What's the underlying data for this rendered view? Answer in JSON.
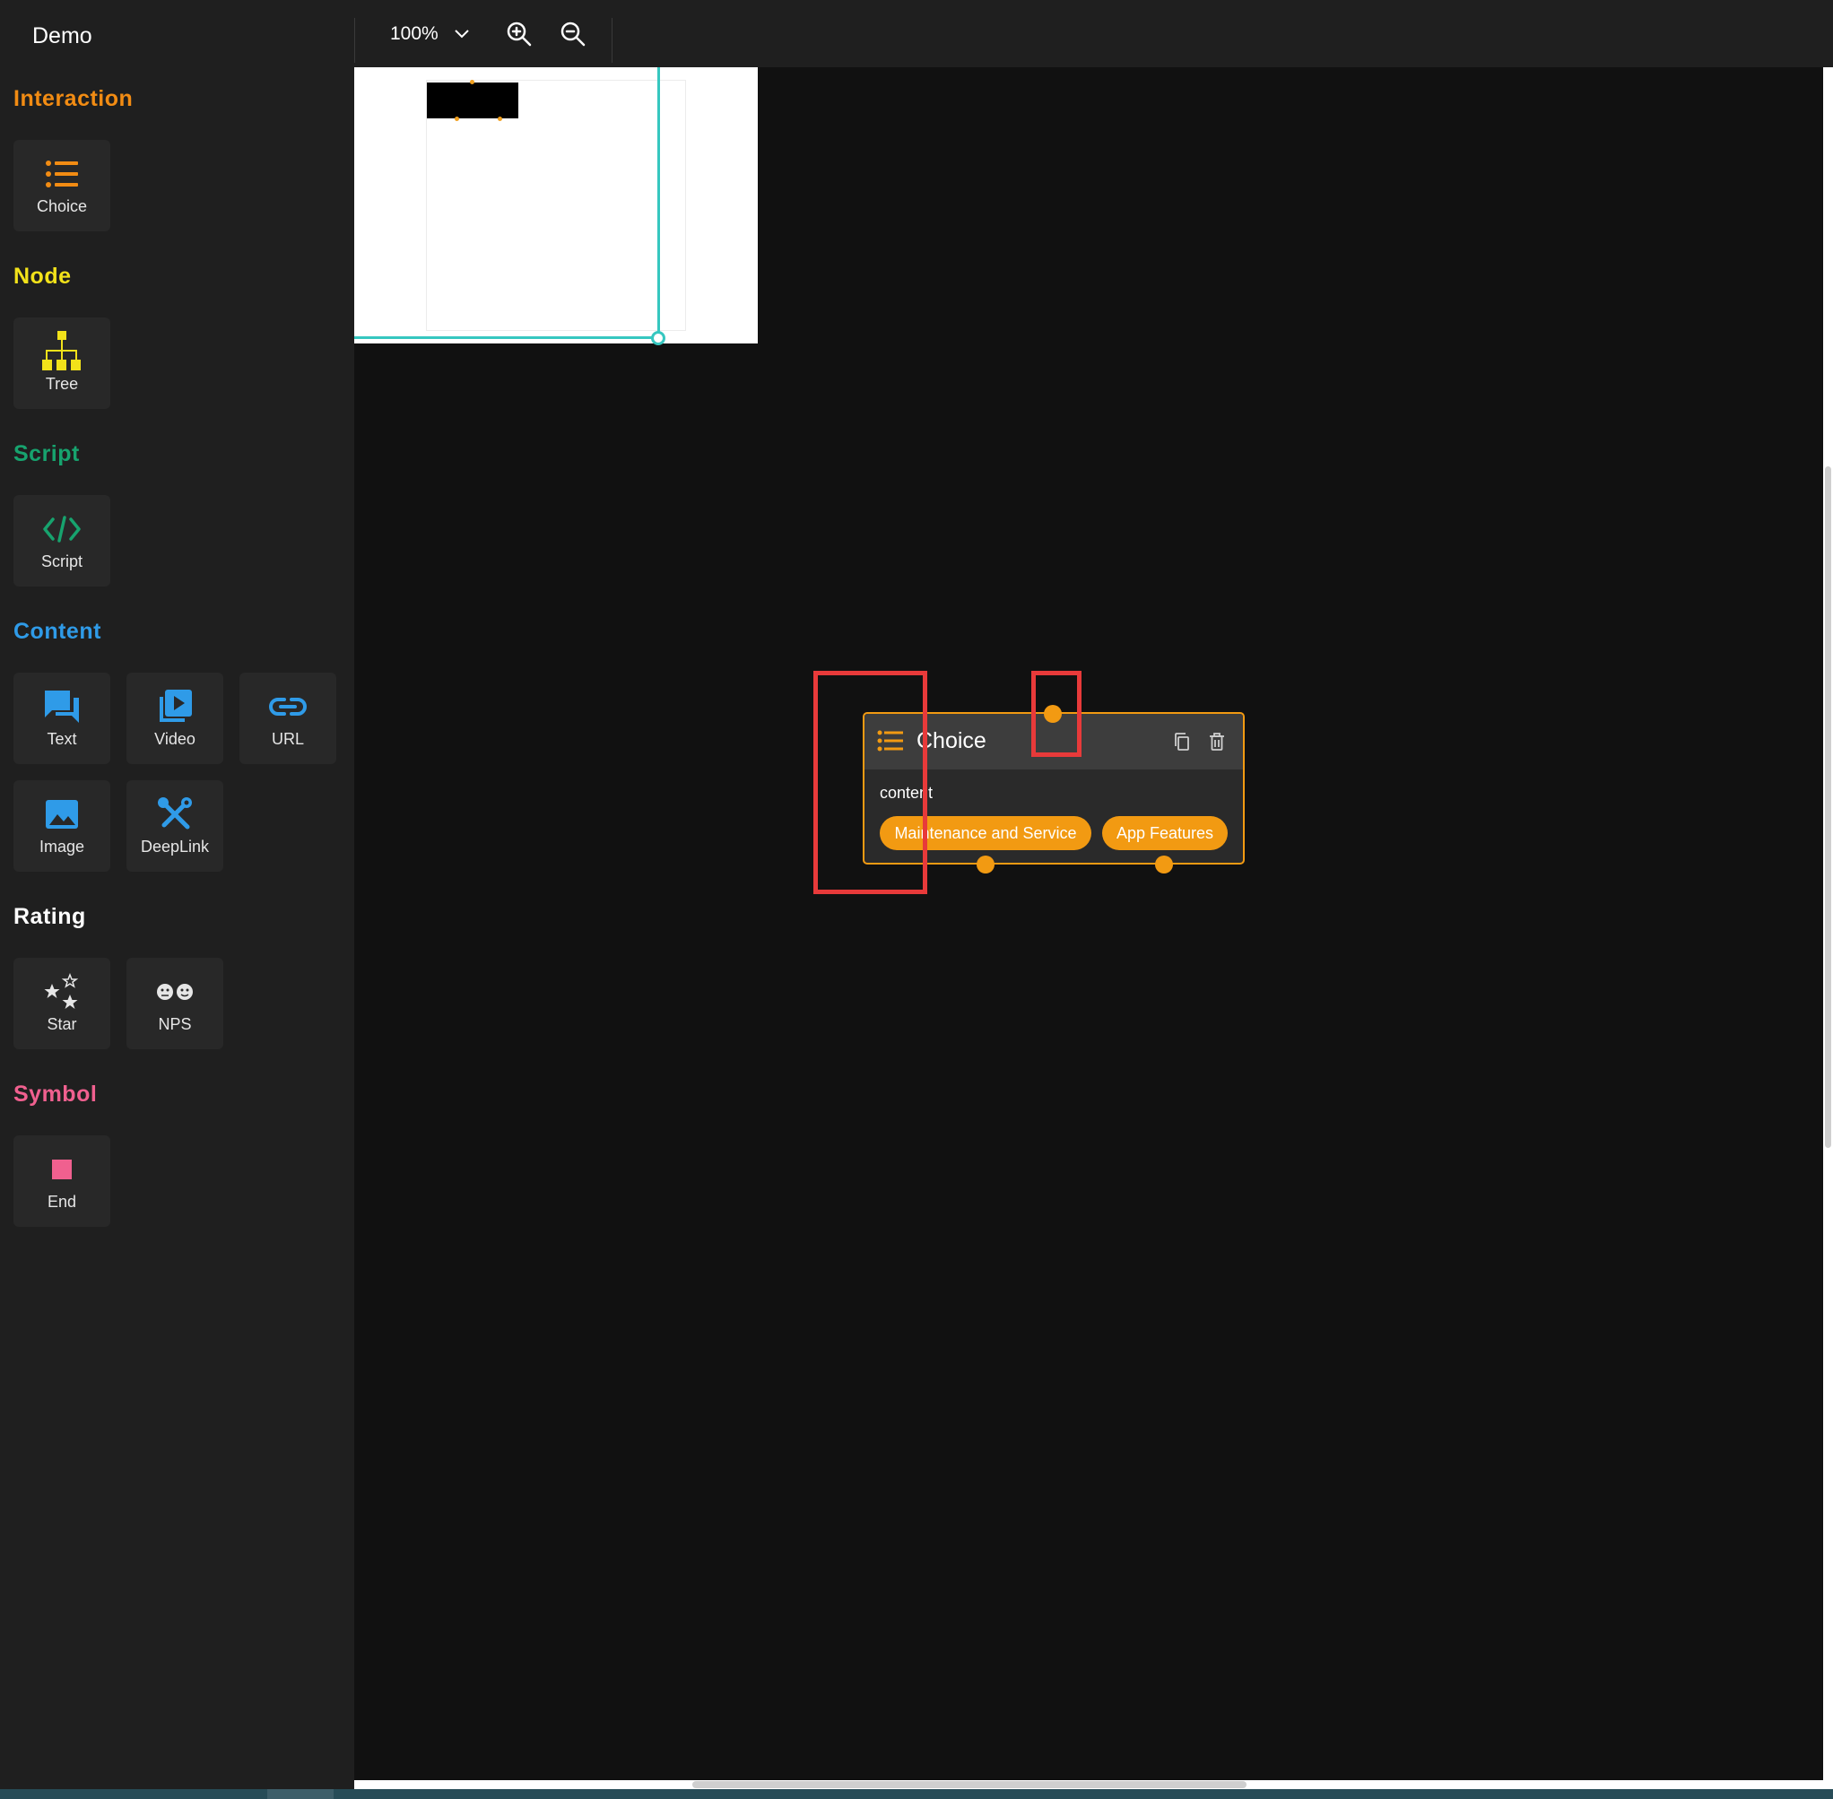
{
  "app": {
    "title": "Demo"
  },
  "toolbar": {
    "zoom": "100%"
  },
  "sidebar": {
    "sections": [
      {
        "title": "Interaction",
        "color": "#f28c13",
        "tools": [
          {
            "label": "Choice",
            "icon": "list-icon"
          }
        ]
      },
      {
        "title": "Node",
        "color": "#f2e21a",
        "tools": [
          {
            "label": "Tree",
            "icon": "tree-icon"
          }
        ]
      },
      {
        "title": "Script",
        "color": "#17a36e",
        "tools": [
          {
            "label": "Script",
            "icon": "code-icon"
          }
        ]
      },
      {
        "title": "Content",
        "color": "#2f9be8",
        "tools": [
          {
            "label": "Text",
            "icon": "chat-icon"
          },
          {
            "label": "Video",
            "icon": "video-icon"
          },
          {
            "label": "URL",
            "icon": "link-icon"
          },
          {
            "label": "Image",
            "icon": "image-icon"
          },
          {
            "label": "DeepLink",
            "icon": "tools-icon"
          }
        ]
      },
      {
        "title": "Rating",
        "color": "#ffffff",
        "tools": [
          {
            "label": "Star",
            "icon": "stars-icon"
          },
          {
            "label": "NPS",
            "icon": "faces-icon"
          }
        ]
      },
      {
        "title": "Symbol",
        "color": "#f0608f",
        "tools": [
          {
            "label": "End",
            "icon": "square-icon"
          }
        ]
      }
    ]
  },
  "node": {
    "title": "Choice",
    "content": "content",
    "choices": [
      "Maintenance and Service",
      "App Features"
    ],
    "accent": "#f29a12"
  },
  "colors": {
    "minimap_frame": "#36c7c0",
    "annotation": "#e83a3a"
  }
}
